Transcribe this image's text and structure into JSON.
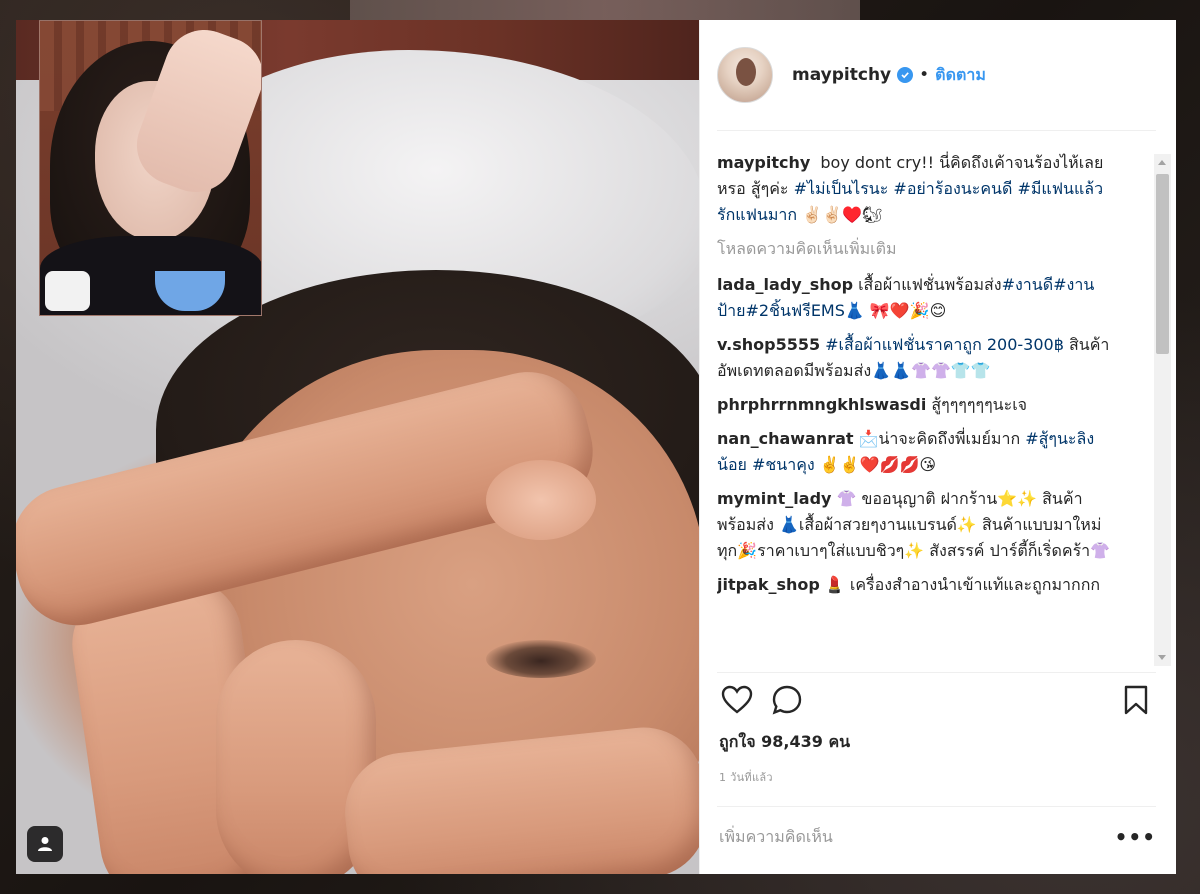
{
  "post": {
    "username": "maypitchy",
    "separator": "•",
    "follow_label": "ติดตาม",
    "caption": {
      "user": "maypitchy",
      "text_parts": [
        {
          "t": "boy dont cry!! นี่คิดถึงเค้าจนร้องไห้เลยหรอ สู้ๆค่ะ ",
          "tag": false
        },
        {
          "t": "#ไม่เป็นไรนะ",
          "tag": true
        },
        {
          "t": " ",
          "tag": false
        },
        {
          "t": "#อย่าร้องนะคนดี",
          "tag": true
        },
        {
          "t": " ",
          "tag": false
        },
        {
          "t": "#มีแฟนแล้วรักแฟนมาก",
          "tag": true
        },
        {
          "t": " ✌🏻✌🏻♥️🐿",
          "tag": false
        }
      ]
    },
    "load_more_label": "โหลดความคิดเห็นเพิ่มเติม",
    "comments": [
      {
        "user": "lada_lady_shop",
        "parts": [
          {
            "t": "เสื้อผ้าแฟชั่นพร้อมส่ง",
            "tag": false
          },
          {
            "t": "#งานดี",
            "tag": true
          },
          {
            "t": "#งานป้าย",
            "tag": true
          },
          {
            "t": "#2ชิ้นฟรีEMS",
            "tag": true
          },
          {
            "t": "👗 🎀❤️🎉😊",
            "tag": false
          }
        ]
      },
      {
        "user": "v.shop5555",
        "parts": [
          {
            "t": "#เสื้อผ้าแฟชั่นราคาถูก 200-300฿",
            "tag": true
          },
          {
            "t": " สินค้าอัพเดทตลอดมีพร้อมส่ง👗👗👚👚👕👕",
            "tag": false
          }
        ]
      },
      {
        "user": "phrphrrnmngkhlswasdi",
        "parts": [
          {
            "t": "สู้ๆๆๆๆๆๆนะเจ",
            "tag": false
          }
        ]
      },
      {
        "user": "nan_chawanrat",
        "parts": [
          {
            "t": "📩น่าจะคิดถึงพี่เมย์มาก ",
            "tag": false
          },
          {
            "t": "#สู้ๆนะลิงน้อย",
            "tag": true
          },
          {
            "t": " ",
            "tag": false
          },
          {
            "t": "#ชนาคุง",
            "tag": true
          },
          {
            "t": " ✌️✌️❤️💋💋😘",
            "tag": false
          }
        ]
      },
      {
        "user": "mymint_lady",
        "parts": [
          {
            "t": "👚 ขออนุญาติ ฝากร้าน⭐️✨ สินค้า พร้อมส่ง 👗เสื้อผ้าสวยๆงานแบรนด์✨ สินค้าแบบมาใหม่ ทุก🎉ราคาเบาๆใส่แบบชิวๆ✨ สังสรรค์ ปาร์ตี้ก็เริ่ดคร้า👚",
            "tag": false
          }
        ]
      },
      {
        "user": "jitpak_shop",
        "parts": [
          {
            "t": "💄 เครื่องสำอางนำเข้าแท้และถูกมากกก",
            "tag": false
          }
        ]
      }
    ],
    "likes_text": "ถูกใจ 98,439 คน",
    "time_ago": "1 วันที่แล้ว",
    "add_comment_placeholder": "เพิ่มความคิดเห็น",
    "more_label": "•••",
    "icons": {
      "like": "heart-icon",
      "comment": "comment-bubble-icon",
      "save": "bookmark-icon",
      "verified": "verified-badge-icon",
      "user_tags": "user-tag-icon"
    },
    "colors": {
      "accent": "#3897f0",
      "hashtag": "#003569",
      "text": "#262626",
      "muted": "#999999"
    }
  }
}
